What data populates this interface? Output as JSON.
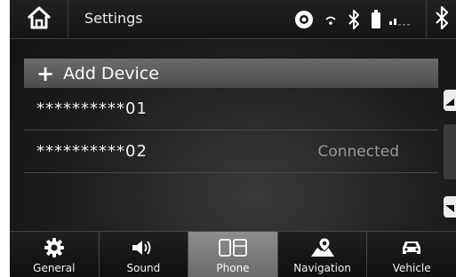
{
  "header": {
    "title": "Settings",
    "home_icon": "home-icon",
    "status_icons": [
      "record-icon",
      "wifi-icon",
      "bluetooth-icon",
      "battery-icon",
      "signal-icon"
    ],
    "bluetooth_button_icon": "bluetooth-icon"
  },
  "list": {
    "add_device_label": "Add Device",
    "devices": [
      {
        "name": "**********01",
        "status": ""
      },
      {
        "name": "**********02",
        "status": "Connected"
      }
    ]
  },
  "tabs": [
    {
      "label": "General",
      "icon": "gear-icon",
      "active": false
    },
    {
      "label": "Sound",
      "icon": "speaker-icon",
      "active": false
    },
    {
      "label": "Phone",
      "icon": "phone-icon",
      "active": true
    },
    {
      "label": "Navigation",
      "icon": "navigation-icon",
      "active": false
    },
    {
      "label": "Vehicle",
      "icon": "car-icon",
      "active": false
    }
  ],
  "colors": {
    "background": "#1c1c1c",
    "active_tab": "#7d7d7d",
    "add_row": "#5c5c5c",
    "status_text": "#9a9a9a"
  }
}
